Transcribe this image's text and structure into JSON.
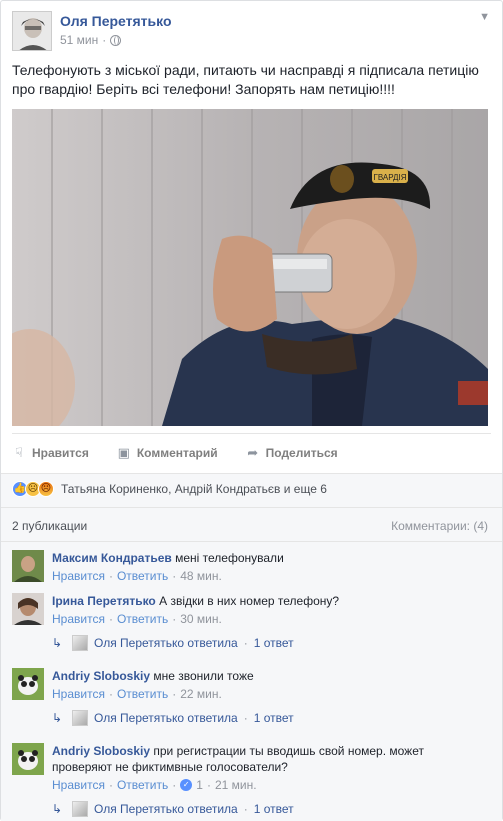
{
  "post": {
    "author": "Оля Перетятько",
    "time": "51 мин",
    "text": "Телефонують з міської ради, питають чи насправді я підписала петицію про гвардію! Беріть всі телефони! Запорять нам петицію!!!!",
    "cap_badge": "ГВАРДІЯ"
  },
  "actions": {
    "like": "Нравится",
    "comment": "Комментарий",
    "share": "Поделиться"
  },
  "reactions": {
    "names": "Татьяна Кориненко, Андрій Кондратьєв и еще 6"
  },
  "stats": {
    "publications": "2 публикации",
    "comments_count": "Комментарии: (4)"
  },
  "comments": [
    {
      "author": "Максим Кондратьев",
      "text": "мені телефонували",
      "text_cont": "",
      "like": "Нравится",
      "reply": "Ответить",
      "likes_count": "",
      "time": "48 мин."
    },
    {
      "author": "Ірина Перетятько",
      "text": "А звідки в них номер телефону?",
      "text_cont": "",
      "like": "Нравится",
      "reply": "Ответить",
      "likes_count": "",
      "time": "30 мин.",
      "reply_name": "Оля Перетятько ответила",
      "reply_count": "1 ответ"
    },
    {
      "author": "Andriy Sloboskiy",
      "text": "мне звонили тоже",
      "text_cont": "",
      "like": "Нравится",
      "reply": "Ответить",
      "likes_count": "",
      "time": "22 мин.",
      "reply_name": "Оля Перетятько ответила",
      "reply_count": "1 ответ"
    },
    {
      "author": "Andriy Sloboskiy",
      "text": "при регистрации ты вводишь свой номер. может",
      "text_cont": "проверяют не фиктимвные голосователи?",
      "like": "Нравится",
      "reply": "Ответить",
      "likes_count": "1",
      "time": "21 мин.",
      "reply_name": "Оля Перетятько ответила",
      "reply_count": "1 ответ"
    }
  ],
  "reply_sep": "·",
  "colors": {
    "link": "#365899",
    "meta": "#90949c",
    "like_blue": "#5890ff"
  }
}
